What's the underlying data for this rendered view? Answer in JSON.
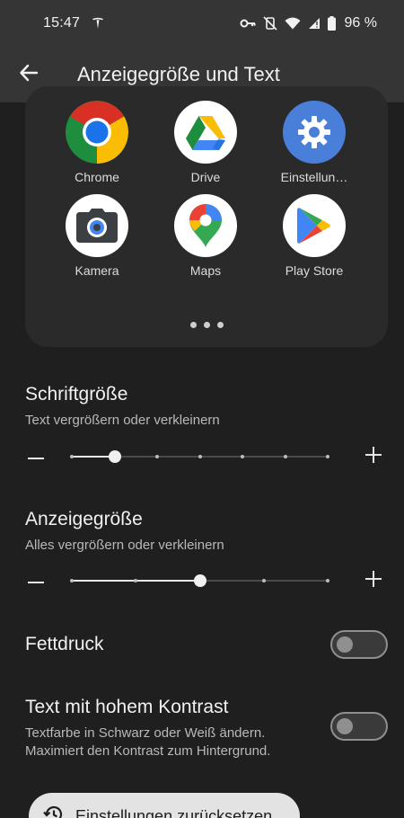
{
  "status_bar": {
    "time": "15:47",
    "battery": "96 %",
    "icons": [
      "tesla-icon",
      "key-icon",
      "mute-vibrate-icon",
      "wifi-icon",
      "signal-icon",
      "battery-icon"
    ]
  },
  "app_bar": {
    "title": "Anzeigegröße und Text",
    "back_icon": "arrow-back-icon"
  },
  "preview": {
    "apps": [
      {
        "label": "Chrome",
        "icon": "chrome-icon"
      },
      {
        "label": "Drive",
        "icon": "drive-icon"
      },
      {
        "label": "Einstellun…",
        "icon": "settings-gear-icon"
      },
      {
        "label": "Kamera",
        "icon": "camera-icon"
      },
      {
        "label": "Maps",
        "icon": "maps-pin-icon"
      },
      {
        "label": "Play Store",
        "icon": "play-store-icon"
      }
    ],
    "page_dots": 3
  },
  "font_size": {
    "title": "Schriftgröße",
    "subtitle": "Text vergrößern oder verkleinern",
    "steps": 7,
    "selected_step": 2
  },
  "display_size": {
    "title": "Anzeigegröße",
    "subtitle": "Alles vergrößern oder verkleinern",
    "steps": 5,
    "selected_step": 3
  },
  "bold_text": {
    "title": "Fettdruck",
    "enabled": false
  },
  "high_contrast": {
    "title": "Text mit hohem Kontrast",
    "subtitle_line1": "Textfarbe in Schwarz oder Weiß ändern.",
    "subtitle_line2": "Maximiert den Kontrast zum Hintergrund.",
    "enabled": false
  },
  "reset": {
    "label": "Einstellungen zurücksetzen",
    "icon": "history-icon"
  },
  "colors": {
    "background": "#1f1f1f",
    "app_bar": "#353535",
    "card": "#2a2a2a",
    "accent": "#f0f0f0"
  }
}
